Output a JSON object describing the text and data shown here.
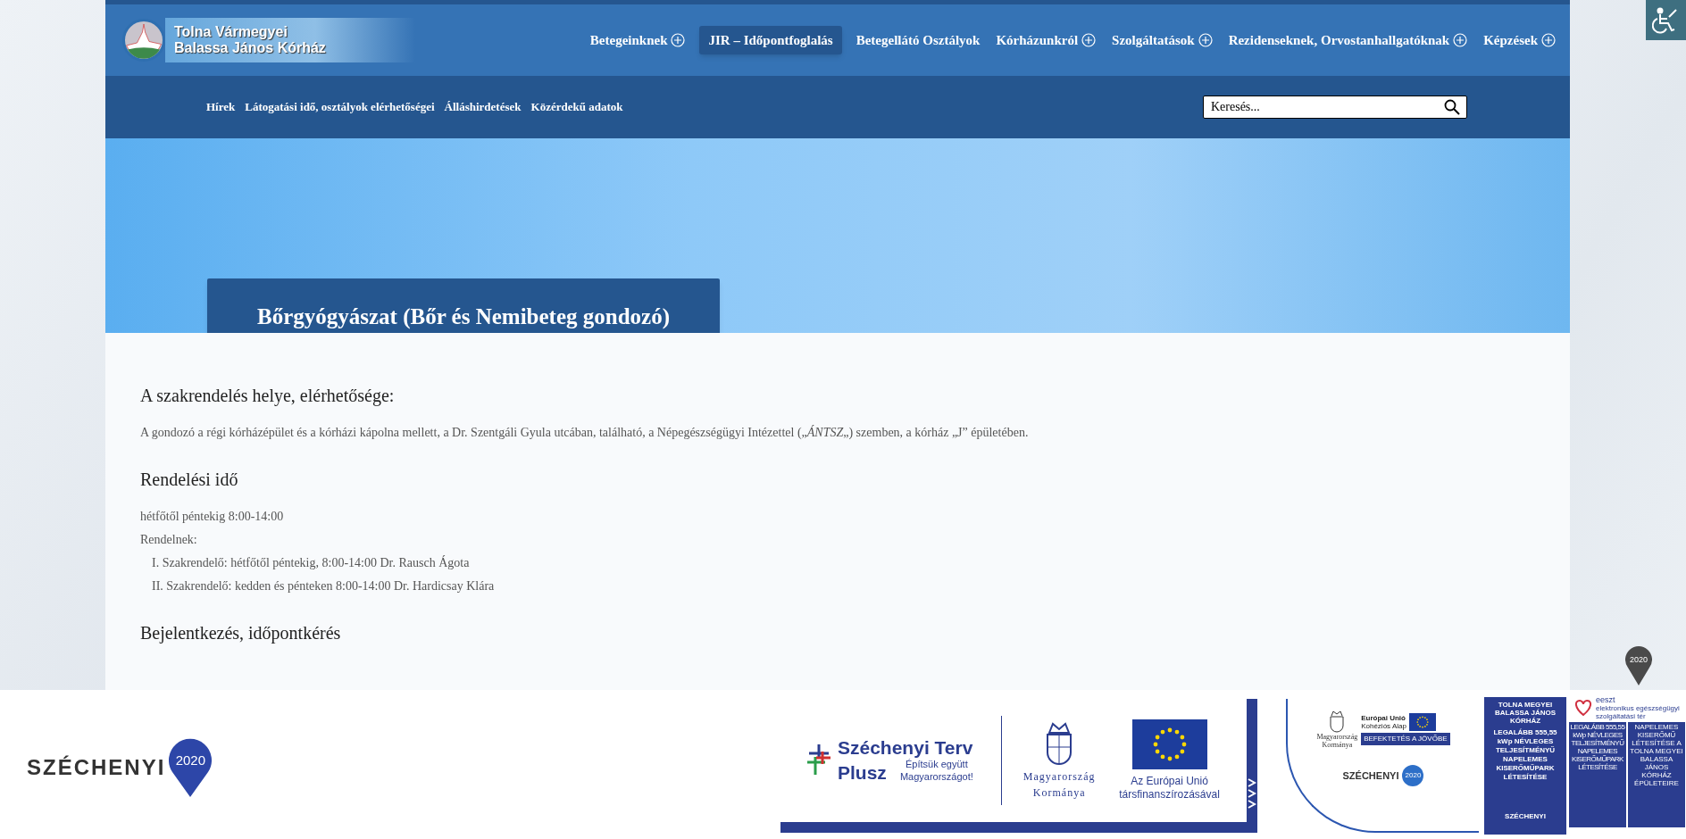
{
  "header": {
    "logo": {
      "lines": [
        "Tolna Vármegyei",
        "Balassa János Kórház"
      ]
    },
    "main_nav": [
      {
        "label": "Betegeinknek",
        "has_submenu": true,
        "selected": false
      },
      {
        "label": "JIR – Időpontfoglalás",
        "has_submenu": false,
        "selected": true
      },
      {
        "label": "Betegellátó Osztályok",
        "has_submenu": false,
        "selected": false
      },
      {
        "label": "Kórházunkról",
        "has_submenu": true,
        "selected": false
      },
      {
        "label": "Szolgáltatások",
        "has_submenu": true,
        "selected": false
      },
      {
        "label": "Rezidenseknek, Orvostanhallgatóknak",
        "has_submenu": true,
        "selected": false
      },
      {
        "label": "Képzések",
        "has_submenu": true,
        "selected": false
      }
    ],
    "sub_nav": [
      "Hírek",
      "Látogatási idő, osztályok elérhetőségei",
      "Álláshirdetések",
      "Közérdekű adatok"
    ],
    "search": {
      "placeholder": "Keresés..."
    }
  },
  "page_title": "Bőrgyógyászat (Bőr és Nemibeteg gondozó)",
  "sections": [
    {
      "heading": "A szakrendelés helye, elérhetősége:",
      "lines": [
        {
          "kind": "paragraph",
          "text": "A gondozó a régi kórházépület és a kórházi kápolna mellett, a Dr. Szentgáli Gyula utcában, található, a Népegészségügyi Intézettel („*ÁNTSZ*„) szemben, a kórház „J” épületében."
        }
      ]
    },
    {
      "heading": "Rendelési idő",
      "lines": [
        {
          "kind": "line",
          "text": "hétfőtől péntekig 8:00-14:00"
        },
        {
          "kind": "line",
          "text": "Rendelnek:"
        },
        {
          "kind": "list_item",
          "text": "I. Szakrendelő: hétfőtől péntekig, 8:00-14:00 Dr. Rausch Ágota"
        },
        {
          "kind": "list_item",
          "text": "II. Szakrendelő: kedden és pénteken 8:00-14:00 Dr. Hardicsay Klára"
        }
      ]
    },
    {
      "heading": "Bejelentkezés, időpontkérés"
    }
  ],
  "floating_badge": {
    "text": "2020"
  },
  "footer": {
    "szechenyi_logo": {
      "word": "SZÉCHENYI",
      "year": "2020"
    },
    "banner": {
      "plan_title": "Széchenyi Terv",
      "plan_word": "Plusz",
      "slogan": "Építsük együtt Magyarországot!",
      "government": [
        "Magyarország",
        "Kormánya"
      ],
      "eu": "Az Európai Unió társfinanszírozásával"
    },
    "banner2": {
      "government": [
        "Magyarország",
        "Kormánya"
      ],
      "fund": [
        "Európai Unió",
        "Kohéziós Alap"
      ],
      "motto": "BEFEKTETÉS A JÖVŐBE",
      "word": "SZÉCHENYI",
      "year": "2020"
    },
    "posters": [
      {
        "header": "TOLNA MEGYEI BALASSA JÁNOS KÓRHÁZ",
        "body": "LEGALÁBB 555,55 kWp NÉVLEGES TELJESÍTMÉNYŰ NAPELEMES KISERŐMŰPARK LÉTESÍTÉSE",
        "word": "SZÉCHENYI"
      },
      {
        "header": "eeszt",
        "subheader": "elektronikus egészségügyi szolgáltatási tér",
        "body": "LEGALÁBB 555,55 kWp NÉVLEGES TELJESÍTMÉNYŰ NAPELEMES KISERŐMŰPARK LÉTESÍTÉSE",
        "body2": "NAPELEMES KISERŐMŰ LÉTESÍTÉSE A TOLNA MEGYEI BALASSA JÁNOS KÓRHÁZ ÉPÜLETEIRE"
      }
    ]
  }
}
